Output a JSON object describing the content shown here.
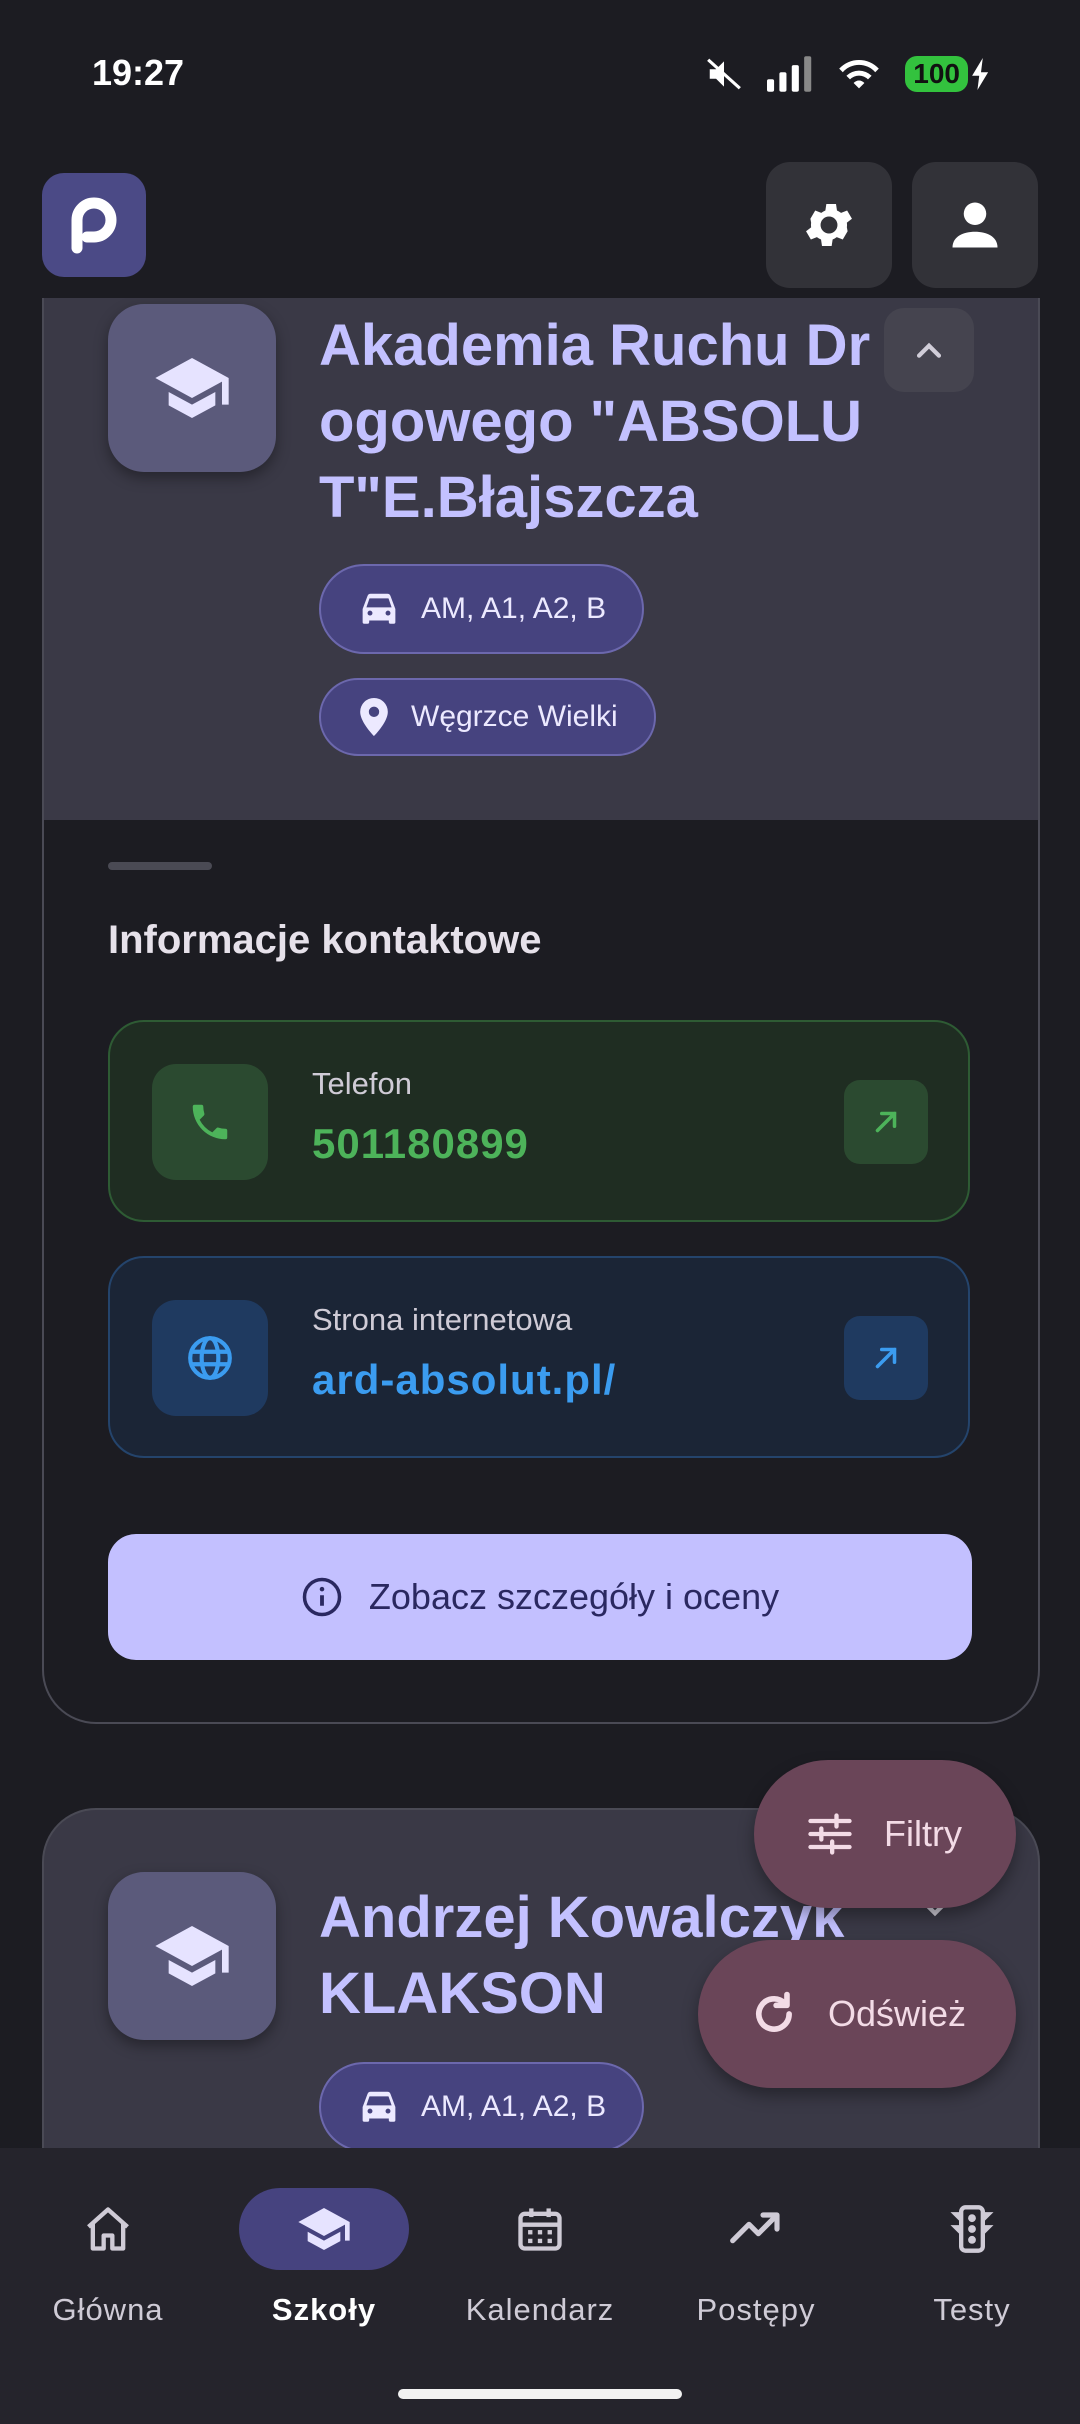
{
  "status_bar": {
    "time": "19:27",
    "battery": "100"
  },
  "header": {
    "logo_icon": "p-logo-icon",
    "settings_icon": "gear-icon",
    "profile_icon": "person-icon"
  },
  "school1": {
    "name": "Akademia Ruchu Drogowego \"ABSOLUT\"E.Błajszcza",
    "categories": "AM, A1, A2, B",
    "location": "Węgrzce Wielki",
    "contact_title": "Informacje kontaktowe",
    "phone_label": "Telefon",
    "phone_value": "501180899",
    "web_label": "Strona internetowa",
    "web_value": "ard-absolut.pl/",
    "details_button": "Zobacz szczegóły i oceny"
  },
  "school2": {
    "name": "Andrzej Kowalczyk KLAKSON",
    "categories": "AM, A1, A2, B"
  },
  "fab": {
    "filters": "Filtry",
    "refresh": "Odśwież"
  },
  "nav": {
    "items": [
      {
        "label": "Główna",
        "icon": "home-icon"
      },
      {
        "label": "Szkoły",
        "icon": "school-icon",
        "active": true
      },
      {
        "label": "Kalendarz",
        "icon": "calendar-icon"
      },
      {
        "label": "Postępy",
        "icon": "trending-up-icon"
      },
      {
        "label": "Testy",
        "icon": "traffic-light-icon"
      }
    ]
  },
  "colors": {
    "accent": "#c3c0ff",
    "phone_green": "#4db35a",
    "web_blue": "#3b9cf0",
    "fab": "#6a4558"
  }
}
